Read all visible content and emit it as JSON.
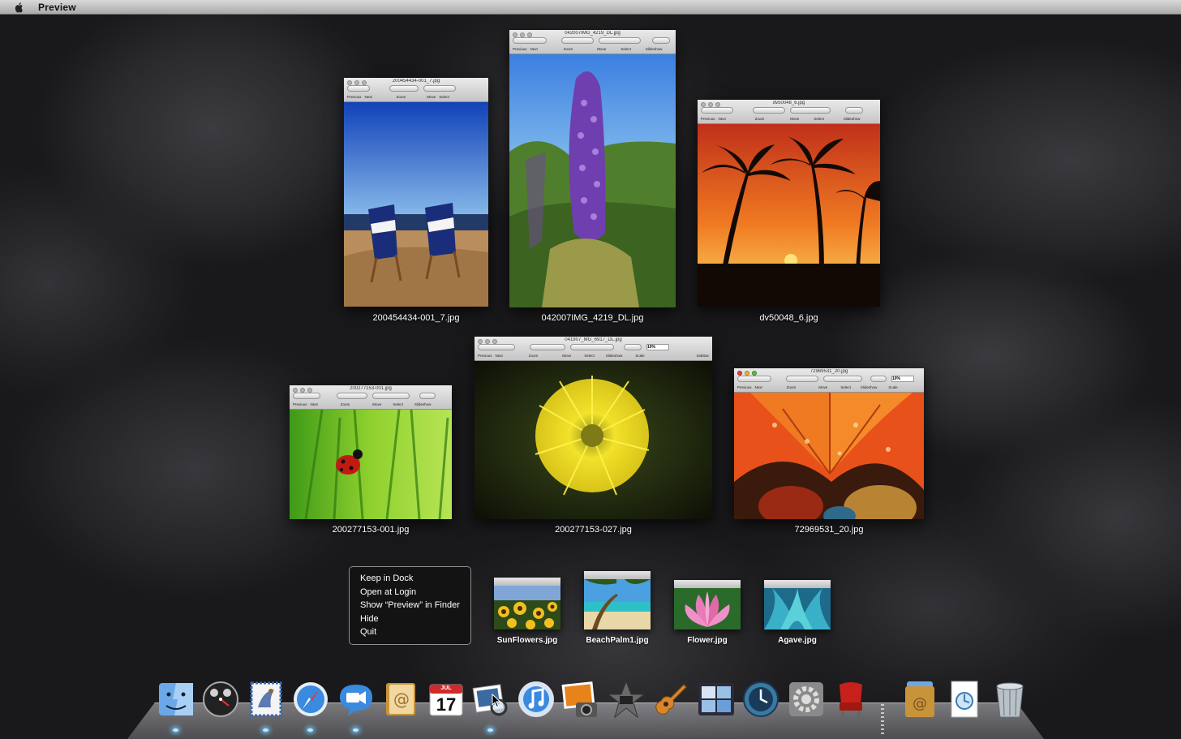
{
  "menubar": {
    "app_name": "Preview"
  },
  "windows": [
    {
      "title": "200454434-001_7.jpg",
      "label": "200454434-001_7.jpg",
      "toolbar": [
        "Previous",
        "Next",
        "Zoom",
        "Move",
        "Select"
      ]
    },
    {
      "title": "042007IMG_4219_DL.jpg",
      "label": "042007IMG_4219_DL.jpg",
      "toolbar": [
        "Previous",
        "Next",
        "Zoom",
        "Move",
        "Select",
        "Slideshow"
      ]
    },
    {
      "title": "dv50048_6.jpg",
      "label": "dv50048_6.jpg",
      "toolbar": [
        "Previous",
        "Next",
        "Zoom",
        "Move",
        "Select",
        "Slideshow"
      ]
    },
    {
      "title": "200277153-001.jpg",
      "label": "200277153-001.jpg",
      "toolbar": [
        "Previous",
        "Next",
        "Zoom",
        "Move",
        "Select",
        "Slideshow"
      ]
    },
    {
      "title": "041907_MG_6917_DL.jpg",
      "label": "200277153-027.jpg",
      "toolbar": [
        "Previous",
        "Next",
        "Zoom",
        "Move",
        "Select",
        "Slideshow",
        "Scale",
        "Sidebar"
      ],
      "scale_value": "10%"
    },
    {
      "title": "72969531_20.jpg",
      "label": "72969531_20.jpg",
      "toolbar": [
        "Previous",
        "Next",
        "Zoom",
        "Move",
        "Select",
        "Slideshow",
        "Scale"
      ],
      "scale_value": "10%"
    }
  ],
  "context_menu": {
    "items": [
      "Keep in Dock",
      "Open at Login",
      "Show “Preview” in Finder",
      "Hide",
      "Quit"
    ]
  },
  "minimized": [
    {
      "label": "SunFlowers.jpg"
    },
    {
      "label": "BeachPalm1.jpg"
    },
    {
      "label": "Flower.jpg"
    },
    {
      "label": "Agave.jpg"
    }
  ],
  "dock": {
    "calendar_month": "JUL",
    "calendar_day": "17",
    "icons": [
      "finder-icon",
      "dashboard-icon",
      "mail-icon",
      "safari-icon",
      "ichat-icon",
      "address-book-icon",
      "ical-icon",
      "preview-icon",
      "itunes-icon",
      "iphoto-icon",
      "imovie-icon",
      "garageband-icon",
      "spaces-icon",
      "time-machine-icon",
      "system-preferences-icon",
      "front-row-icon",
      "applications-stack-icon",
      "documents-stack-icon",
      "trash-icon"
    ]
  },
  "colors": {
    "accent_glow": "#6cc8ff",
    "menubar": "#c8c8c8"
  }
}
